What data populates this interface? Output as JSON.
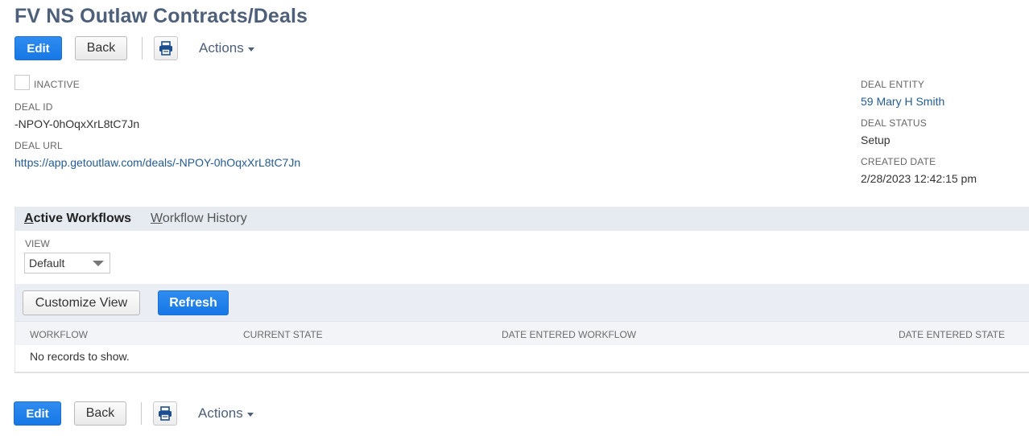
{
  "page": {
    "title": "FV NS Outlaw Contracts/Deals"
  },
  "toolbar": {
    "edit_label": "Edit",
    "back_label": "Back",
    "actions_label": "Actions"
  },
  "fields": {
    "inactive_label": "INACTIVE",
    "deal_id_label": "DEAL ID",
    "deal_id_value": "-NPOY-0hOqxXrL8tC7Jn",
    "deal_url_label": "DEAL URL",
    "deal_url_value": "https://app.getoutlaw.com/deals/-NPOY-0hOqxXrL8tC7Jn",
    "deal_entity_label": "DEAL ENTITY",
    "deal_entity_value": "59 Mary H Smith",
    "deal_status_label": "DEAL STATUS",
    "deal_status_value": "Setup",
    "created_date_label": "CREATED DATE",
    "created_date_value": "2/28/2023 12:42:15 pm"
  },
  "workflows": {
    "tabs": [
      {
        "label_underlined": "A",
        "label_rest": "ctive Workflows"
      },
      {
        "label_underlined": "W",
        "label_rest": "orkflow History"
      }
    ],
    "view_label": "VIEW",
    "view_selected": "Default",
    "customize_view_label": "Customize View",
    "refresh_label": "Refresh",
    "columns": [
      "WORKFLOW",
      "CURRENT STATE",
      "DATE ENTERED WORKFLOW",
      "DATE ENTERED STATE"
    ],
    "empty_message": "No records to show."
  },
  "colors": {
    "primary_button": "#1677e6",
    "title": "#4d5f79",
    "link": "#255b92"
  }
}
